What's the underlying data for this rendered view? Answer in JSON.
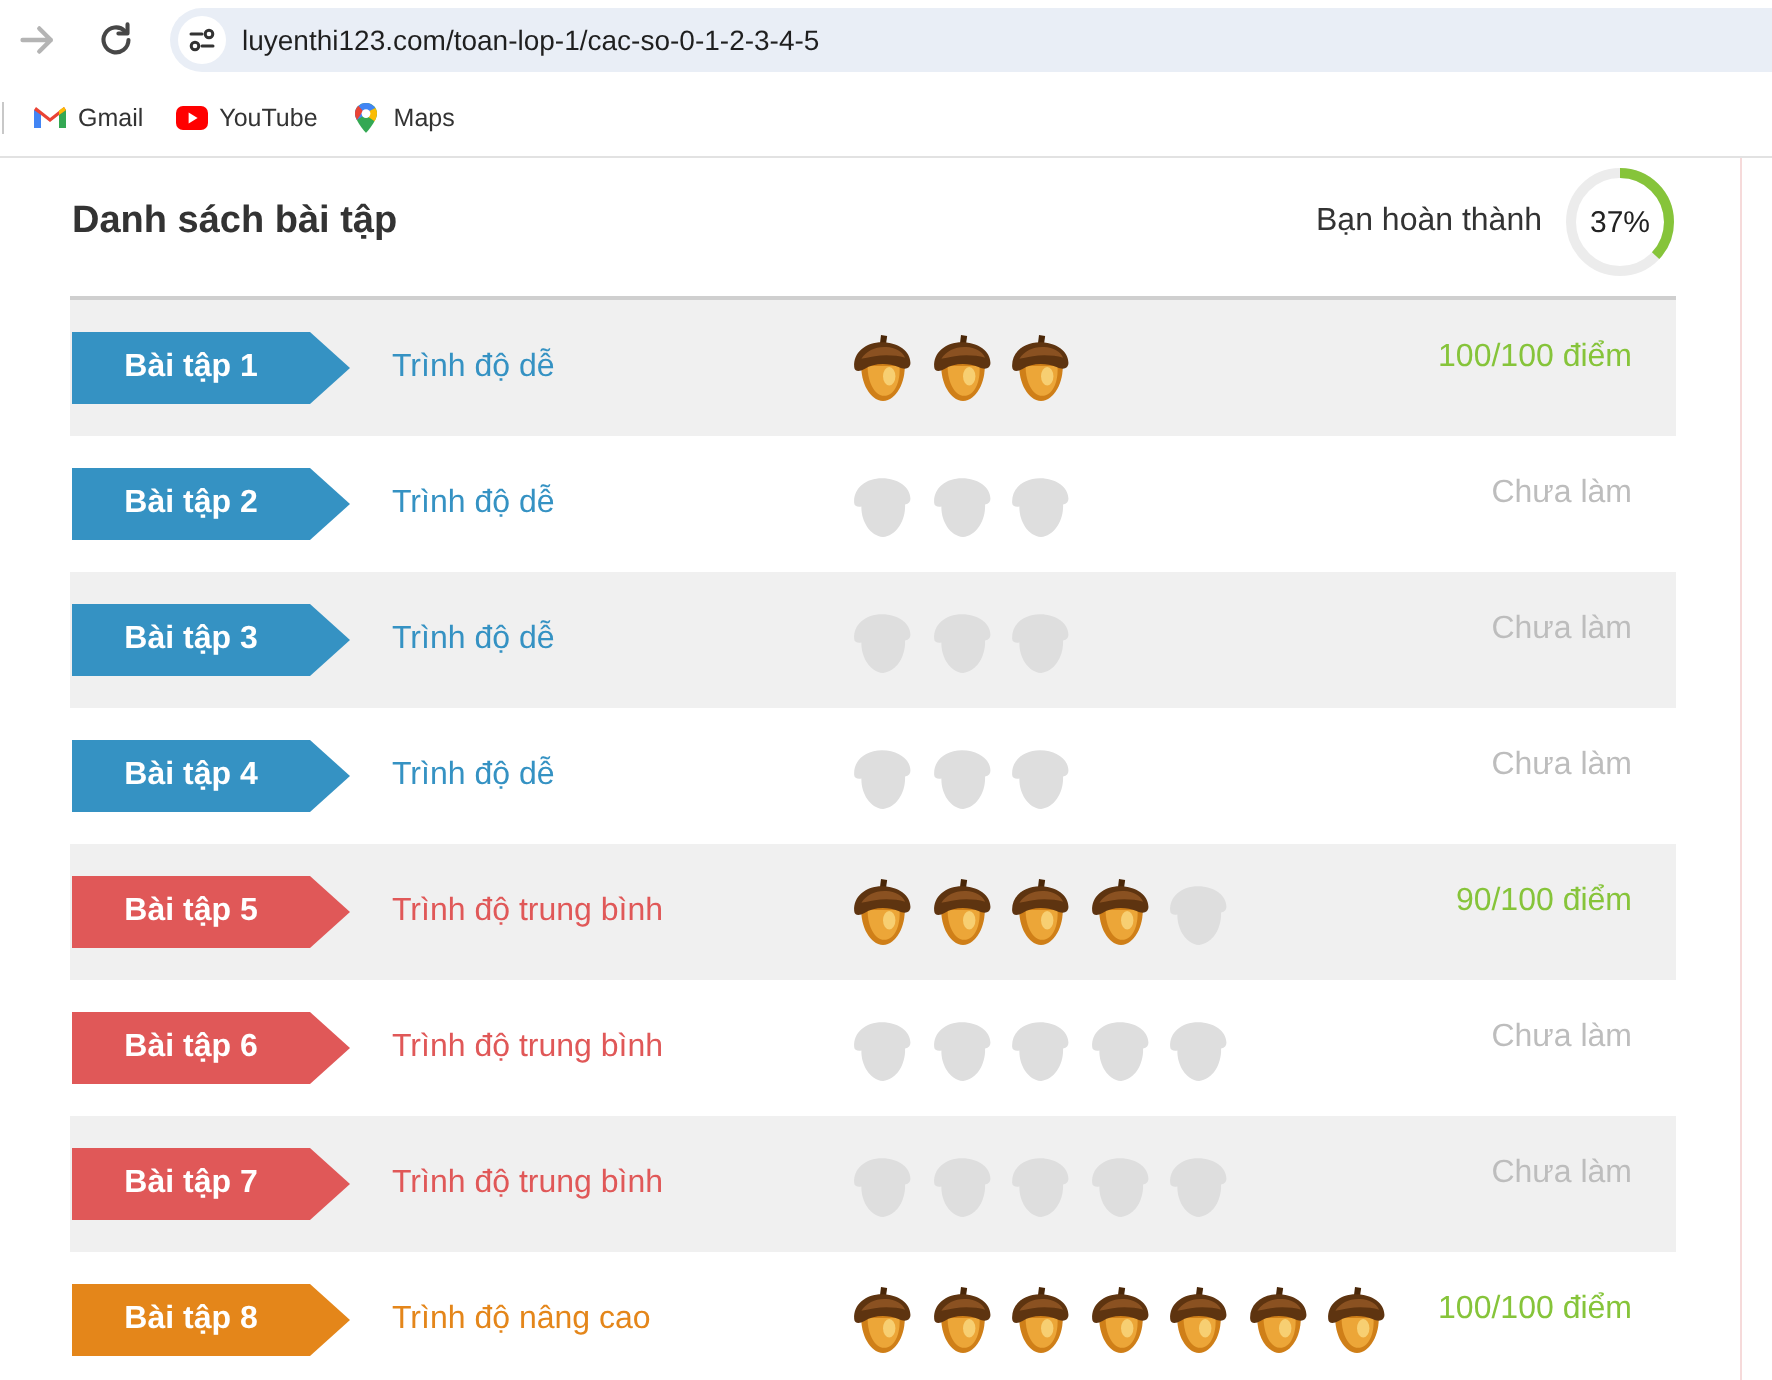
{
  "browser": {
    "forward": {
      "disabled": true
    },
    "url": "luyenthi123.com/toan-lop-1/cac-so-0-1-2-3-4-5",
    "bookmarks": [
      {
        "label": "Gmail",
        "kind": "gmail"
      },
      {
        "label": "YouTube",
        "kind": "youtube"
      },
      {
        "label": "Maps",
        "kind": "maps"
      }
    ]
  },
  "page": {
    "title": "Danh sách bài tập",
    "progress": {
      "label": "Bạn hoàn thành",
      "level": 0.37,
      "reading": "37%"
    },
    "exercises": [
      {
        "label": "Bài tập 1",
        "difficulty": "Trình độ dễ",
        "color": "#3592c3",
        "acorns": [
          {
            "filled": true
          },
          {
            "filled": true
          },
          {
            "filled": true
          }
        ],
        "completed": true,
        "score": "100/100 điểm"
      },
      {
        "label": "Bài tập 2",
        "difficulty": "Trình độ dễ",
        "color": "#3592c3",
        "acorns": [
          {
            "filled": false
          },
          {
            "filled": false
          },
          {
            "filled": false
          }
        ],
        "completed": false,
        "score": "Chưa làm"
      },
      {
        "label": "Bài tập 3",
        "difficulty": "Trình độ dễ",
        "color": "#3592c3",
        "acorns": [
          {
            "filled": false
          },
          {
            "filled": false
          },
          {
            "filled": false
          }
        ],
        "completed": false,
        "score": "Chưa làm"
      },
      {
        "label": "Bài tập 4",
        "difficulty": "Trình độ dễ",
        "color": "#3592c3",
        "acorns": [
          {
            "filled": false
          },
          {
            "filled": false
          },
          {
            "filled": false
          }
        ],
        "completed": false,
        "score": "Chưa làm"
      },
      {
        "label": "Bài tập 5",
        "difficulty": "Trình độ trung bình",
        "color": "#e05858",
        "acorns": [
          {
            "filled": true
          },
          {
            "filled": true
          },
          {
            "filled": true
          },
          {
            "filled": true
          },
          {
            "filled": false
          }
        ],
        "completed": true,
        "score": "90/100 điểm"
      },
      {
        "label": "Bài tập 6",
        "difficulty": "Trình độ trung bình",
        "color": "#e05858",
        "acorns": [
          {
            "filled": false
          },
          {
            "filled": false
          },
          {
            "filled": false
          },
          {
            "filled": false
          },
          {
            "filled": false
          }
        ],
        "completed": false,
        "score": "Chưa làm"
      },
      {
        "label": "Bài tập 7",
        "difficulty": "Trình độ trung bình",
        "color": "#e05858",
        "acorns": [
          {
            "filled": false
          },
          {
            "filled": false
          },
          {
            "filled": false
          },
          {
            "filled": false
          },
          {
            "filled": false
          }
        ],
        "completed": false,
        "score": "Chưa làm"
      },
      {
        "label": "Bài tập 8",
        "difficulty": "Trình độ nâng cao",
        "color": "#e4861a",
        "acorns": [
          {
            "filled": true
          },
          {
            "filled": true
          },
          {
            "filled": true
          },
          {
            "filled": true
          },
          {
            "filled": true
          },
          {
            "filled": true
          },
          {
            "filled": true
          }
        ],
        "completed": true,
        "score": "100/100 điểm"
      }
    ]
  }
}
